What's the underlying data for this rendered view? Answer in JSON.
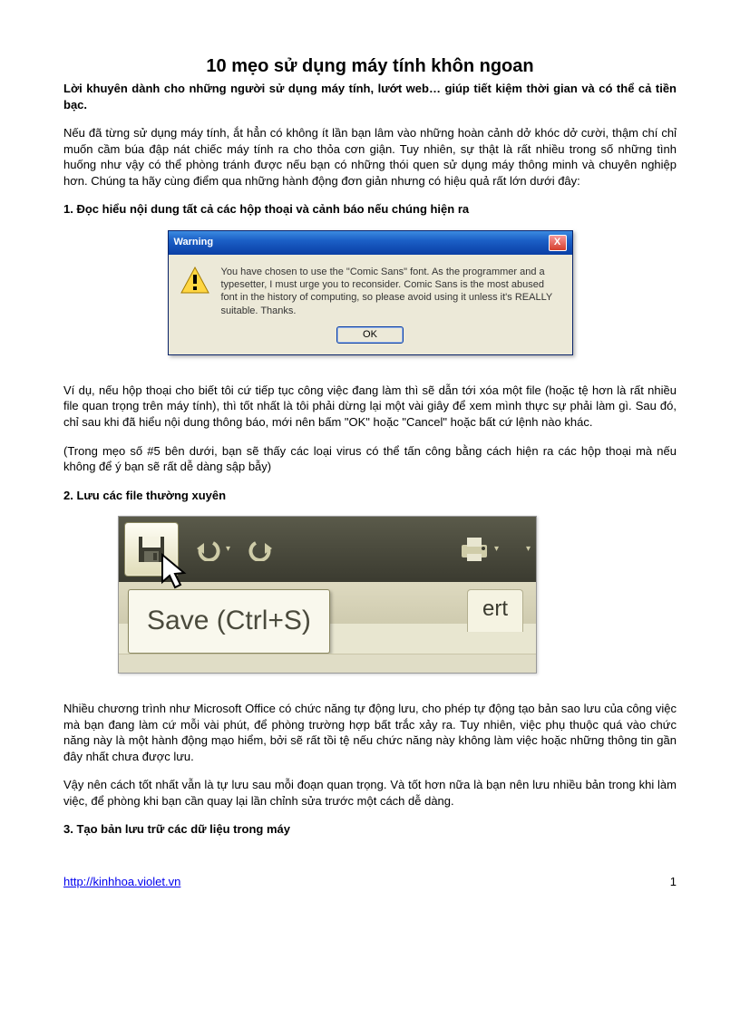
{
  "title": "10 mẹo sử dụng máy tính khôn ngoan",
  "subtitle": "Lời khuyên dành cho những người sử dụng máy tính, lướt web… giúp tiết kiệm thời gian và có thể cả tiền bạc.",
  "intro": "Nếu đã từng sử dụng máy tính, ắt hẳn có không ít lần bạn lâm vào những hoàn cảnh dở khóc dở cười, thậm chí chỉ muốn cầm búa đập nát chiếc máy tính ra cho thỏa cơn giận. Tuy nhiên, sự thật là rất nhiều trong số những tình huống như vậy có thể phòng tránh được nếu bạn có những thói quen sử dụng máy thông minh và chuyên nghiệp hơn. Chúng ta hãy cùng điểm qua những hành động đơn giản nhưng có hiệu quả rất lớn dưới đây:",
  "sections": {
    "s1": "1. Đọc hiểu nội dung tất cả các hộp thoại và cảnh báo nếu chúng hiện ra",
    "s2": "2. Lưu các file thường xuyên",
    "s3": "3. Tạo bản lưu trữ các dữ liệu trong máy"
  },
  "dialog": {
    "title": "Warning",
    "body": "You have chosen to use the \"Comic Sans\" font. As the programmer and a typesetter, I must urge you to reconsider. Comic Sans is the most abused font in the history of computing, so please avoid using it unless it's REALLY suitable. Thanks.",
    "ok": "OK",
    "close": "X"
  },
  "para_after_dialog_1": "Ví dụ, nếu hộp thoại cho biết tôi cứ tiếp tục công việc đang làm thì sẽ dẫn tới xóa một file (hoặc tệ hơn là rất nhiều file quan trọng trên máy tính), thì tốt nhất là tôi phải dừng lại một vài giây để xem mình thực sự phải làm gì. Sau đó, chỉ sau khi đã hiểu nội dung thông báo, mới nên bấm \"OK\" hoặc \"Cancel\" hoặc bất cứ lệnh nào khác.",
  "para_after_dialog_2": "(Trong mẹo số #5 bên dưới, bạn sẽ thấy các loại virus có thể tấn công bằng cách hiện ra các hộp thoại mà nếu không để ý bạn sẽ rất dễ dàng sập bẫy)",
  "toolbar": {
    "tooltip": "Save (Ctrl+S)",
    "tab_partial": "ert"
  },
  "para_after_toolbar_1": "Nhiều chương trình như Microsoft Office có chức năng tự động lưu, cho phép tự động tạo bản sao lưu của công việc mà bạn đang làm cứ mỗi vài phút, để phòng trường hợp bất trắc xảy ra. Tuy nhiên, việc phụ thuộc quá vào chức năng này là một hành động mạo hiểm, bởi sẽ rất tồi tệ nếu chức năng này không làm việc hoặc những thông tin gần đây nhất chưa được lưu.",
  "para_after_toolbar_2": "Vậy nên cách tốt nhất vẫn là tự lưu sau mỗi đoạn quan trọng. Và tốt hơn nữa là bạn nên lưu nhiều bản trong khi làm việc, để phòng khi bạn cần quay lại lần chỉnh sửa trước một cách dễ dàng.",
  "footer": {
    "url": "http://kinhhoa.violet.vn",
    "page": "1"
  }
}
